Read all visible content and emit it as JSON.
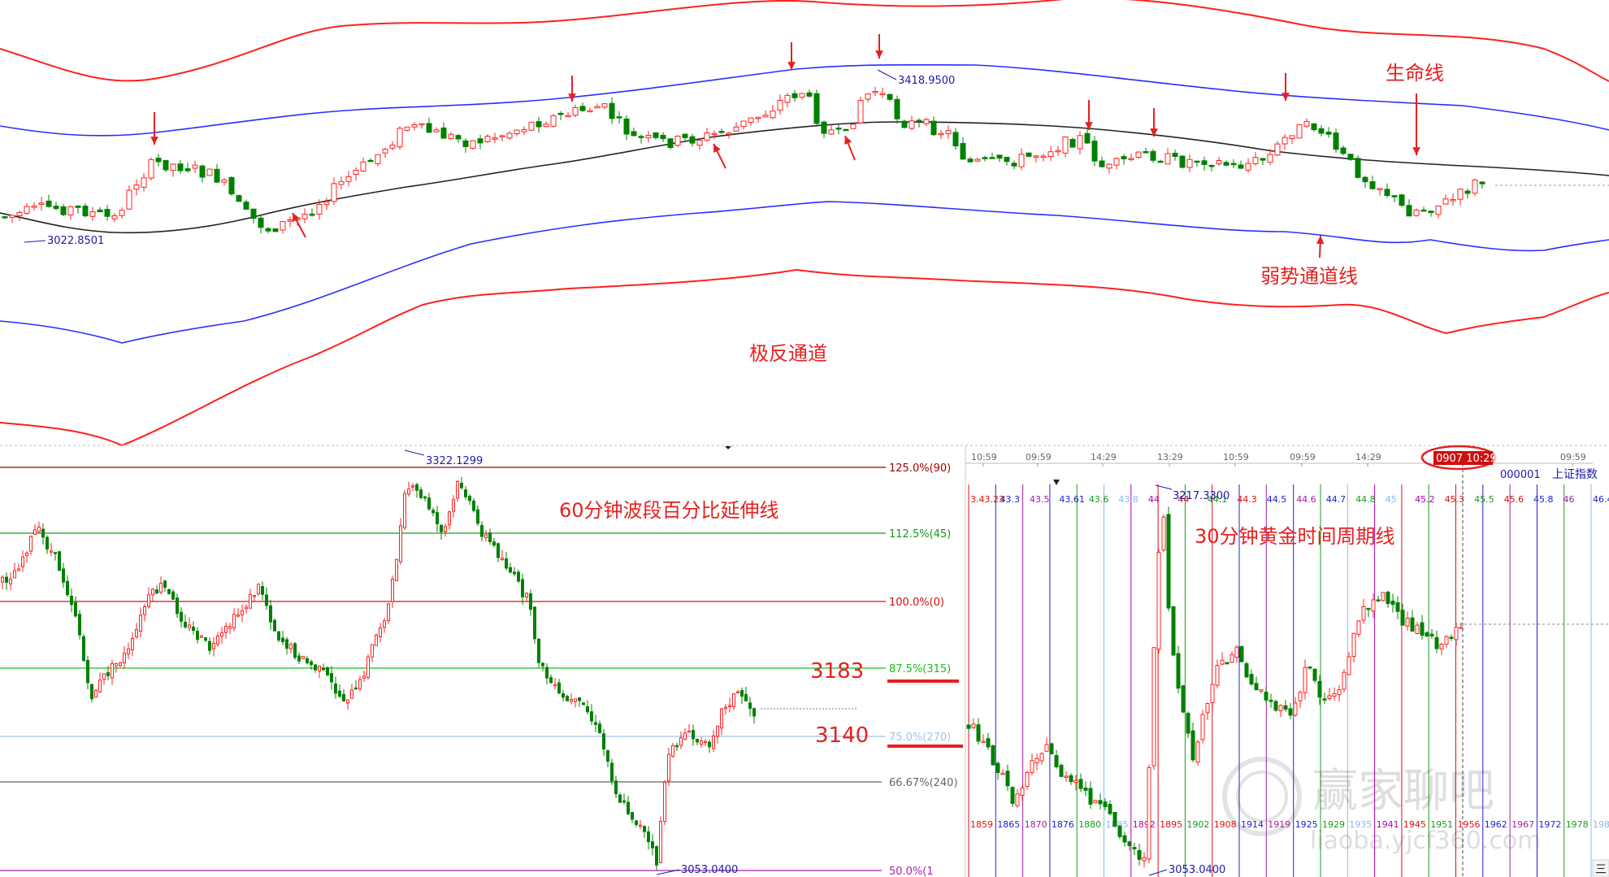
{
  "colors": {
    "up": "#ff2020",
    "down": "#008000",
    "mid": "#222222",
    "channel_red": "#ff2020",
    "channel_blue": "#2b2bff",
    "annot_red": "#e62020",
    "fib_red": "#a00000",
    "fib_green": "#1a9a1a",
    "fib_light": "#9fc4e8",
    "fib_gray": "#666666",
    "fib_purple": "#aa22aa"
  },
  "top": {
    "low_label": "3022.8501",
    "high_label": "3418.9500",
    "annot_life": "生命线",
    "annot_weak": "弱势通道线",
    "annot_extreme": "极反通道"
  },
  "left": {
    "title": "60分钟波段百分比延伸线",
    "high_label": "3322.1299",
    "low_label": "3053.0400",
    "key_3183": "3183",
    "key_3140": "3140",
    "levels": [
      {
        "label": "125.0%(90)",
        "color": "#a00000"
      },
      {
        "label": "112.5%(45)",
        "color": "#1a9a1a"
      },
      {
        "label": "100.0%(0)",
        "color": "#d01010"
      },
      {
        "label": "87.5%(315)",
        "color": "#1aba1a"
      },
      {
        "label": "75.0%(270)",
        "color": "#9fc4e8"
      },
      {
        "label": "66.67%(240)",
        "color": "#666666"
      },
      {
        "label": "50.0%(1",
        "color": "#aa22aa"
      }
    ]
  },
  "right": {
    "title": "30分钟黄金时间周期线",
    "index_code": "000001",
    "index_name": "上证指数",
    "high_label": "3217.3300",
    "low_label": "3053.0400",
    "time_badge": "0907 10:29",
    "time_axis": [
      "10:59",
      "09:59",
      "14:29",
      "13:29",
      "10:59",
      "09:59",
      "14:29",
      "09:59"
    ],
    "right_edge_mark": "三",
    "top_labels": [
      "3.43.23",
      "43.3",
      "43.5",
      "43.61",
      "43.6",
      "43.8",
      "44",
      "44",
      "44.1",
      "44.3",
      "44.5",
      "44.6",
      "44.7",
      "44.8",
      "45",
      "45.2",
      "45.3",
      "45.5",
      "45.6",
      "45.8",
      "46",
      "46.4"
    ],
    "bottom_labels": [
      "1859",
      "1865",
      "1870",
      "1876",
      "1880",
      "1885",
      "1892",
      "1895",
      "1902",
      "1908",
      "1914",
      "1919",
      "1925",
      "1929",
      "1935",
      "1941",
      "1945",
      "1951",
      "1956",
      "1962",
      "1967",
      "1972",
      "1978",
      "1983"
    ]
  },
  "watermark": {
    "name": "赢家聊吧",
    "url": "liaoba.yjcf360.com"
  }
}
